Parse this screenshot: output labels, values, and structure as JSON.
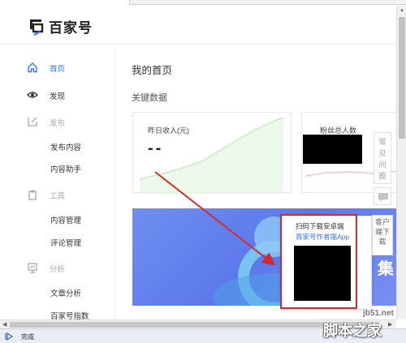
{
  "app": {
    "logo_text": "百家号"
  },
  "sidebar": {
    "home": "首页",
    "discover": "发现",
    "publish": "发布",
    "publish_content": "发布内容",
    "content_assistant": "内容助手",
    "tools": "工具",
    "content_manage": "内容管理",
    "comment_manage": "评论管理",
    "analysis": "分析",
    "article_analysis": "文章分析",
    "bjh_index": "百家号指数"
  },
  "main": {
    "page_title": "我的首页",
    "section_title": "关键数据",
    "card_income_label": "昨日收入(元)",
    "card_income_value": "--",
    "card_fans_label": "粉丝总人数"
  },
  "banner": {
    "text": "集"
  },
  "float": {
    "faq": [
      "常",
      "见",
      "问",
      "题"
    ],
    "service": [
      "客户",
      "端下",
      "载"
    ]
  },
  "qr_popup": {
    "line1": "扫码下载安卓端",
    "line2": "百家号作者端App"
  },
  "status": {
    "text": "完成"
  },
  "watermark": {
    "site": "jb51.net",
    "name": "脚本之家"
  },
  "colors": {
    "accent": "#3b74f0",
    "annotation": "#d42a2a"
  }
}
